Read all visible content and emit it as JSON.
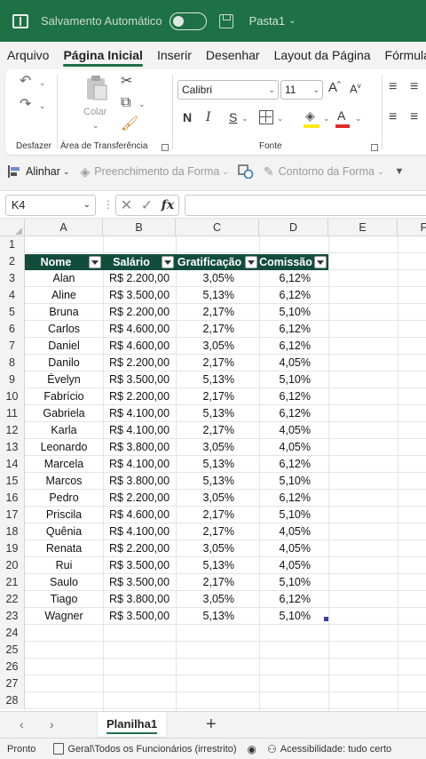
{
  "titlebar": {
    "autosave_label": "Salvamento Automático",
    "filename": "Pasta1"
  },
  "menu_tabs": [
    "Arquivo",
    "Página Inicial",
    "Inserir",
    "Desenhar",
    "Layout da Página",
    "Fórmulas"
  ],
  "ribbon": {
    "undo_group_label": "Desfazer",
    "clipboard": {
      "paste_label": "Colar",
      "group_label": "Área de Transferência"
    },
    "font": {
      "name": "Calibri",
      "size": "11",
      "bold": "N",
      "italic": "I",
      "underline": "S",
      "group_label": "Fonte"
    }
  },
  "shape_strip": {
    "align_label": "Alinhar",
    "fill_label": "Preenchimento da Forma",
    "outline_label": "Contorno da Forma"
  },
  "formula_bar": {
    "name_box": "K4",
    "fx": "fx"
  },
  "sheet": {
    "columns": [
      "A",
      "B",
      "C",
      "D",
      "E",
      "F"
    ],
    "row_numbers": [
      "1",
      "2",
      "3",
      "4",
      "5",
      "6",
      "7",
      "8",
      "9",
      "10",
      "11",
      "12",
      "13",
      "14",
      "15",
      "16",
      "17",
      "18",
      "19",
      "20",
      "21",
      "22",
      "23",
      "24",
      "25",
      "26",
      "27",
      "28"
    ],
    "headers": [
      "Nome",
      "Salário",
      "Gratificação",
      "Comissão"
    ],
    "rows": [
      [
        "Alan",
        "R$ 2.200,00",
        "3,05%",
        "6,12%"
      ],
      [
        "Aline",
        "R$ 3.500,00",
        "5,13%",
        "6,12%"
      ],
      [
        "Bruna",
        "R$ 2.200,00",
        "2,17%",
        "5,10%"
      ],
      [
        "Carlos",
        "R$ 4.600,00",
        "2,17%",
        "6,12%"
      ],
      [
        "Daniel",
        "R$ 4.600,00",
        "3,05%",
        "6,12%"
      ],
      [
        "Danilo",
        "R$ 2.200,00",
        "2,17%",
        "4,05%"
      ],
      [
        "Évelyn",
        "R$ 3.500,00",
        "5,13%",
        "5,10%"
      ],
      [
        "Fabrício",
        "R$ 2.200,00",
        "2,17%",
        "6,12%"
      ],
      [
        "Gabriela",
        "R$ 4.100,00",
        "5,13%",
        "6,12%"
      ],
      [
        "Karla",
        "R$ 4.100,00",
        "2,17%",
        "4,05%"
      ],
      [
        "Leonardo",
        "R$ 3.800,00",
        "3,05%",
        "4,05%"
      ],
      [
        "Marcela",
        "R$ 4.100,00",
        "5,13%",
        "6,12%"
      ],
      [
        "Marcos",
        "R$ 3.800,00",
        "5,13%",
        "5,10%"
      ],
      [
        "Pedro",
        "R$ 2.200,00",
        "3,05%",
        "6,12%"
      ],
      [
        "Priscila",
        "R$ 4.600,00",
        "2,17%",
        "5,10%"
      ],
      [
        "Quênia",
        "R$ 4.100,00",
        "2,17%",
        "4,05%"
      ],
      [
        "Renata",
        "R$ 2.200,00",
        "3,05%",
        "4,05%"
      ],
      [
        "Rui",
        "R$ 3.500,00",
        "5,13%",
        "4,05%"
      ],
      [
        "Saulo",
        "R$ 3.500,00",
        "2,17%",
        "5,10%"
      ],
      [
        "Tiago",
        "R$ 3.800,00",
        "3,05%",
        "6,12%"
      ],
      [
        "Wagner",
        "R$ 3.500,00",
        "5,13%",
        "5,10%"
      ]
    ],
    "sheet_tab": "Planilha1"
  },
  "statusbar": {
    "ready": "Pronto",
    "sensitivity": "Geral\\Todos os Funcionários (irrestrito)",
    "accessibility": "Acessibilidade: tudo certo"
  },
  "colors": {
    "titlebar": "#1e7145",
    "table_header": "#114d3a"
  }
}
